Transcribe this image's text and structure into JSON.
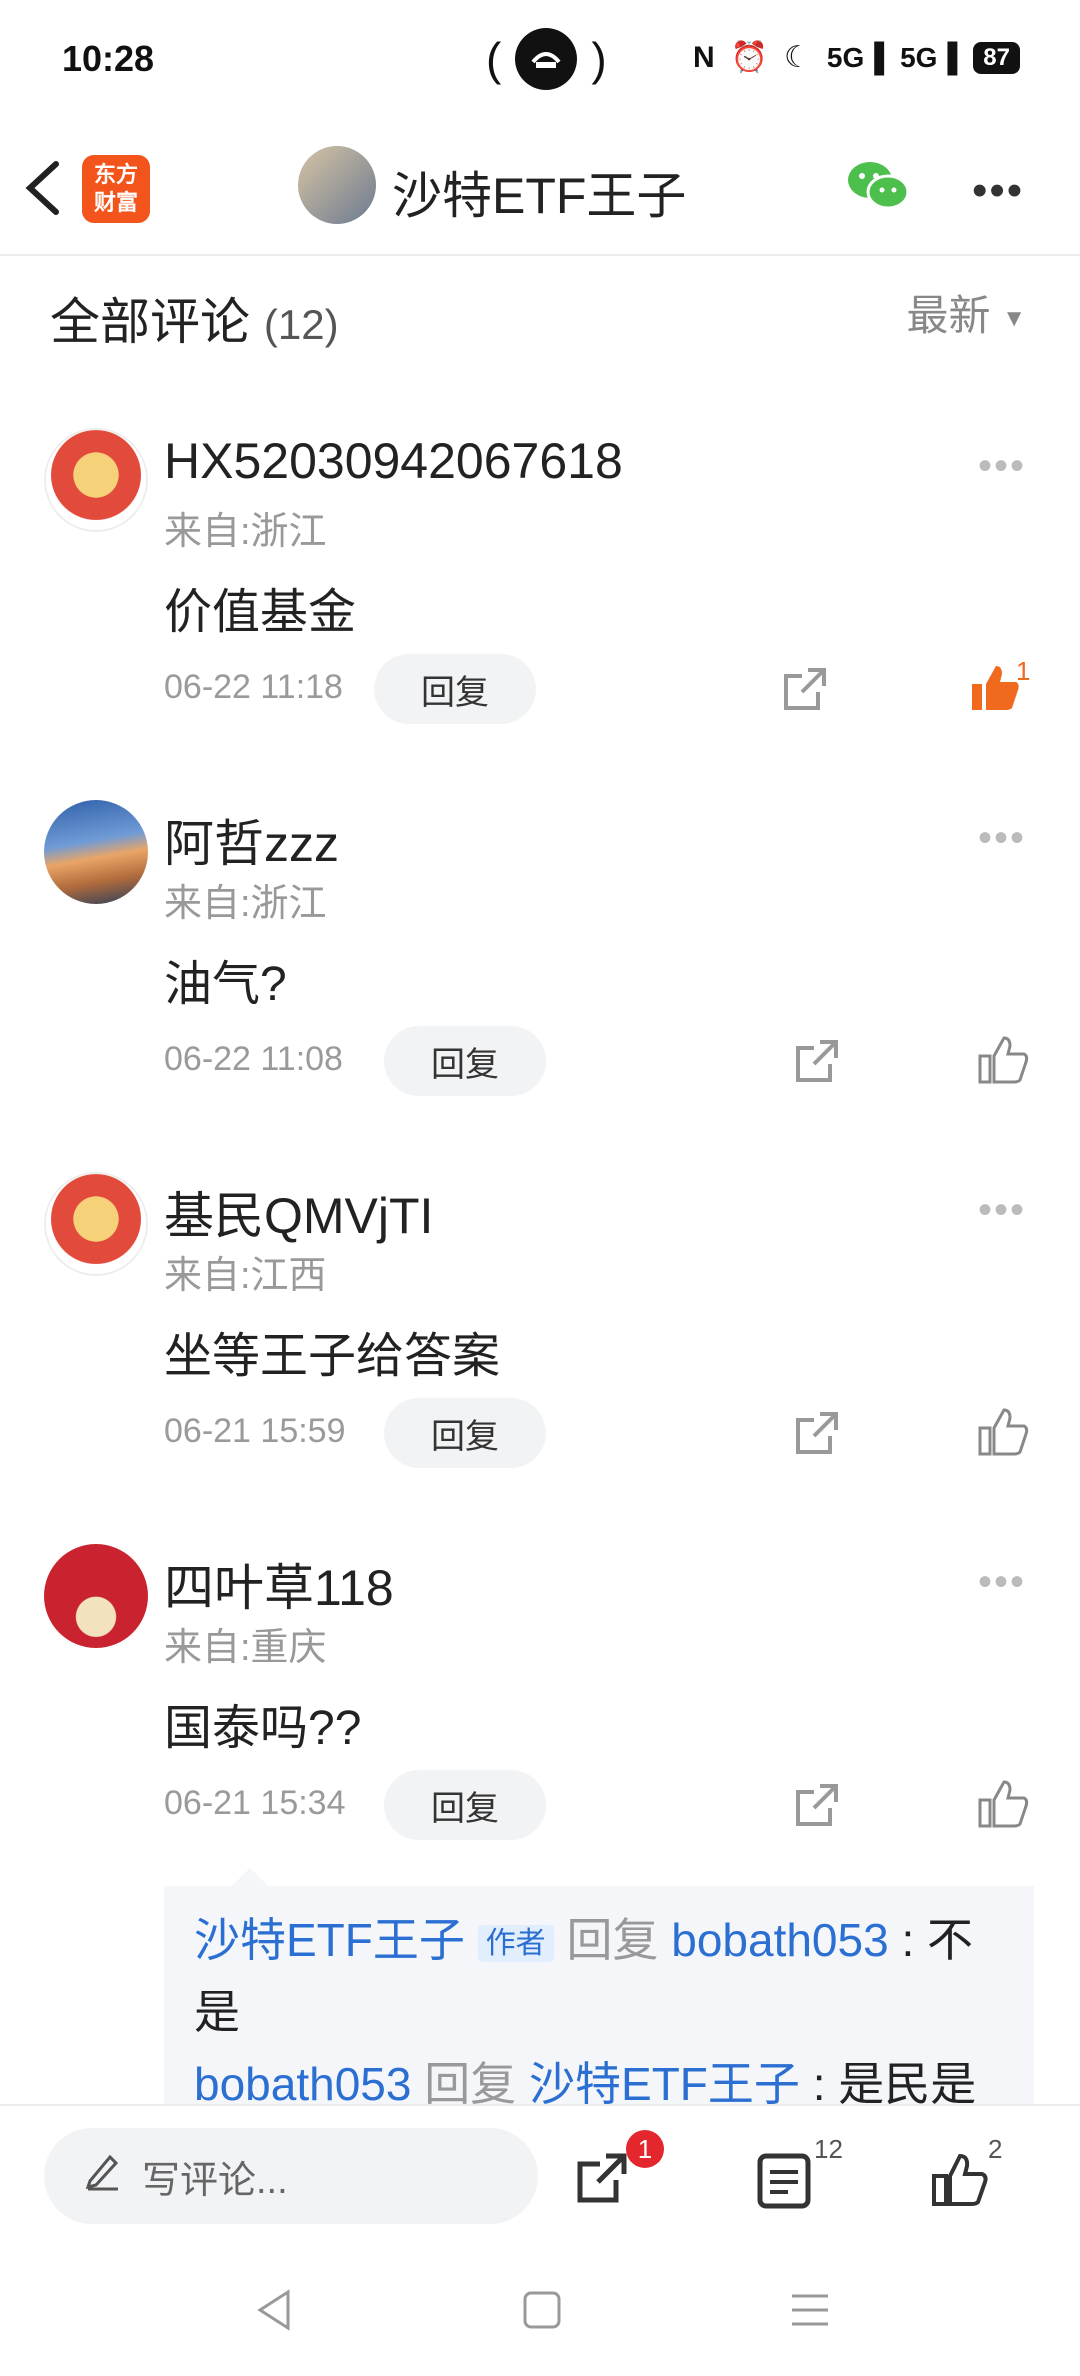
{
  "status": {
    "time": "10:28",
    "battery": "87"
  },
  "header": {
    "logo_top": "东方",
    "logo_bottom": "财富",
    "title": "沙特ETF王子"
  },
  "section": {
    "title": "全部评论",
    "count": "(12)",
    "sort": "最新"
  },
  "comments": [
    {
      "name": "HX52030942067618",
      "location": "来自:浙江",
      "body": "价值基金",
      "time": "06-22 11:18",
      "reply": "回复",
      "likes": "1",
      "liked": true
    },
    {
      "name": "阿哲zzz",
      "location": "来自:浙江",
      "body": "油气?",
      "time": "06-22 11:08",
      "reply": "回复",
      "likes": "",
      "liked": false
    },
    {
      "name": "基民QMVjTI",
      "location": "来自:江西",
      "body": "坐等王子给答案",
      "time": "06-21 15:59",
      "reply": "回复",
      "likes": "",
      "liked": false
    },
    {
      "name": "四叶草118",
      "location": "来自:重庆",
      "body": "国泰吗??",
      "time": "06-21 15:34",
      "reply": "回复",
      "likes": "",
      "liked": false
    }
  ],
  "reply_thread": {
    "r1_user": "沙特ETF王子",
    "r1_tag": "作者",
    "r1_verb": "回复",
    "r1_target": "bobath053",
    "r1_text": ": 不",
    "r1_text2": "是",
    "r2_user": "bobath053",
    "r2_verb": "回复",
    "r2_target": "沙特ETF王子",
    "r2_text": ": 是民是"
  },
  "bottom": {
    "placeholder": "写评论...",
    "share_badge": "1",
    "comment_count": "12",
    "like_count": "2"
  },
  "colors": {
    "accent": "#f2541b",
    "link": "#2a6fd1",
    "wechat": "#4cbf4c"
  }
}
